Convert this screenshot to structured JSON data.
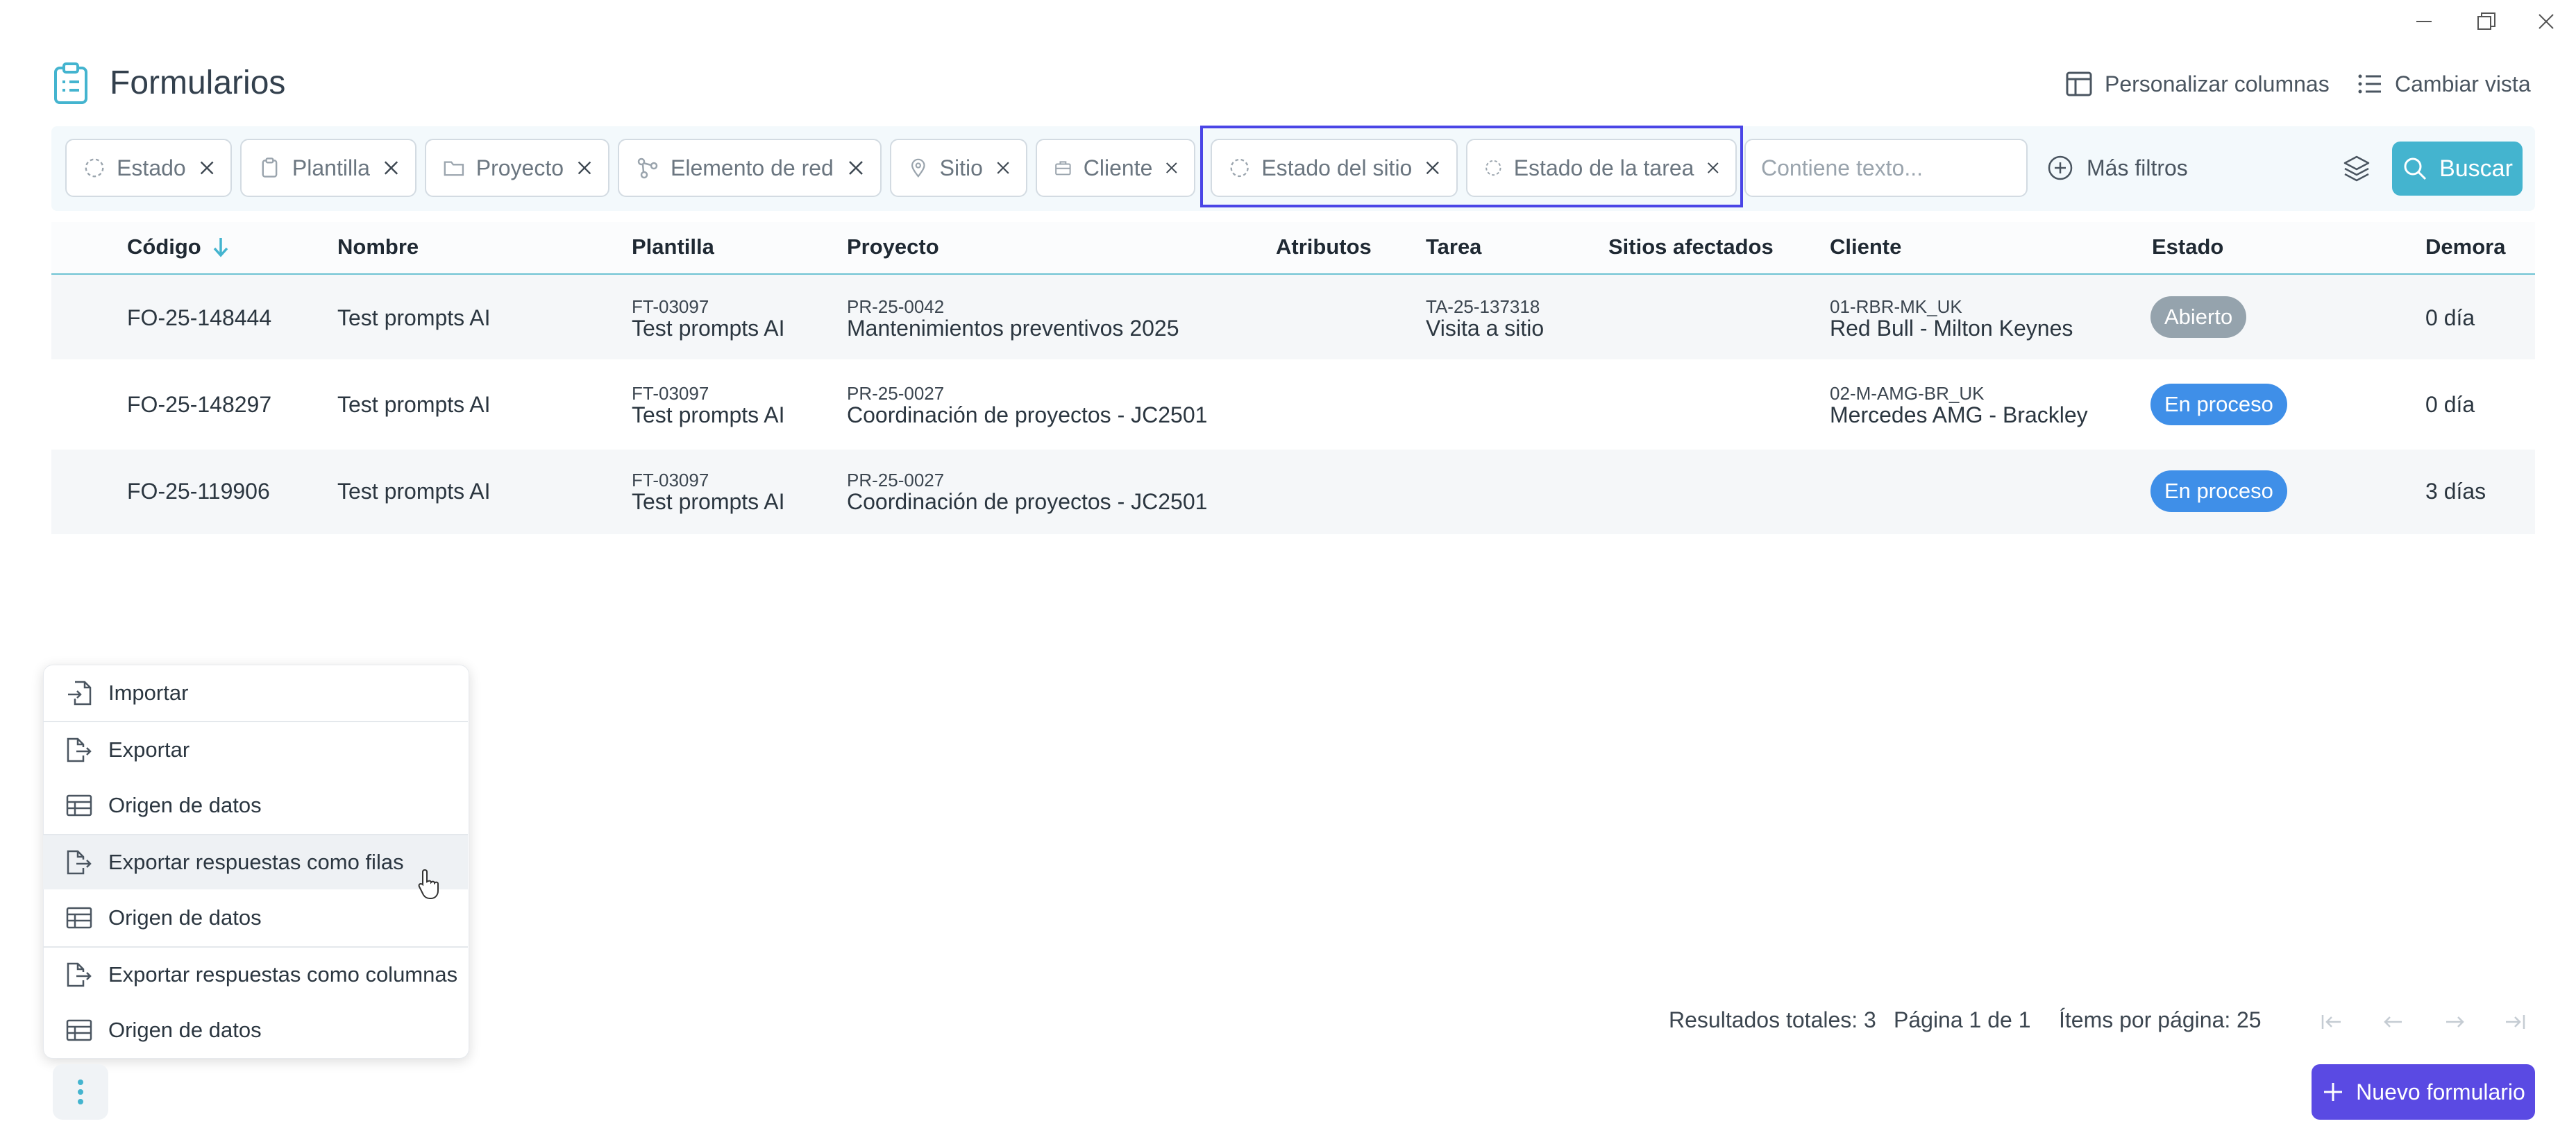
{
  "header": {
    "title": "Formularios",
    "customize_columns": "Personalizar columnas",
    "change_view": "Cambiar vista"
  },
  "filters": {
    "chips": [
      "Estado",
      "Plantilla",
      "Proyecto",
      "Elemento de red",
      "Sitio",
      "Cliente",
      "Estado del sitio",
      "Estado de la tarea"
    ],
    "text_placeholder": "Contiene texto...",
    "more_filters": "Más filtros",
    "search": "Buscar"
  },
  "table": {
    "columns": [
      "Código",
      "Nombre",
      "Plantilla",
      "Proyecto",
      "Atributos",
      "Tarea",
      "Sitios afectados",
      "Cliente",
      "Estado",
      "Demora"
    ],
    "rows": [
      {
        "codigo": "FO-25-148444",
        "nombre": "Test prompts AI",
        "plantilla_code": "FT-03097",
        "plantilla_name": "Test prompts AI",
        "proyecto_code": "PR-25-0042",
        "proyecto_name": "Mantenimientos preventivos 2025",
        "tarea_code": "TA-25-137318",
        "tarea_name": "Visita a sitio",
        "cliente_code": "01-RBR-MK_UK",
        "cliente_name": "Red Bull - Milton Keynes",
        "estado": "Abierto",
        "demora": "0 día"
      },
      {
        "codigo": "FO-25-148297",
        "nombre": "Test prompts AI",
        "plantilla_code": "FT-03097",
        "plantilla_name": "Test prompts AI",
        "proyecto_code": "PR-25-0027",
        "proyecto_name": "Coordinación de proyectos - JC2501",
        "tarea_code": "",
        "tarea_name": "",
        "cliente_code": "02-M-AMG-BR_UK",
        "cliente_name": "Mercedes AMG - Brackley",
        "estado": "En proceso",
        "demora": "0 día"
      },
      {
        "codigo": "FO-25-119906",
        "nombre": "Test prompts AI",
        "plantilla_code": "FT-03097",
        "plantilla_name": "Test prompts AI",
        "proyecto_code": "PR-25-0027",
        "proyecto_name": "Coordinación de proyectos - JC2501",
        "tarea_code": "",
        "tarea_name": "",
        "cliente_code": "",
        "cliente_name": "",
        "estado": "En proceso",
        "demora": "3 días"
      }
    ]
  },
  "menu": {
    "items": [
      "Importar",
      "Exportar",
      "Origen de datos",
      "Exportar respuestas como filas",
      "Origen de datos",
      "Exportar respuestas como columnas",
      "Origen de datos"
    ]
  },
  "pagination": {
    "total": "Resultados totales: 3",
    "page": "Página 1 de 1",
    "per_page_label": "Ítems por página:",
    "per_page_value": "25"
  },
  "new_form": "Nuevo formulario",
  "colors": {
    "accent": "#44b4cf",
    "primary": "#5a4ae3",
    "badge_open": "#95a3ad",
    "badge_in_progress": "#3f8fe8",
    "highlight": "#4a45e6"
  }
}
